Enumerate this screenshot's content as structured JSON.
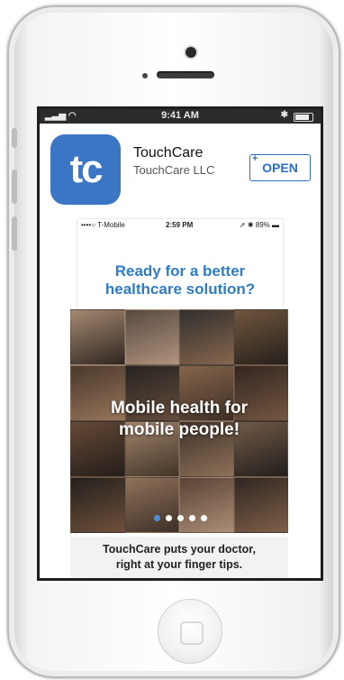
{
  "status_bar": {
    "time": "9:41 AM"
  },
  "app": {
    "icon_text": "tc",
    "name": "TouchCare",
    "developer": "TouchCare LLC",
    "open_label": "OPEN",
    "open_plus": "+"
  },
  "preview": {
    "status": {
      "carrier": "••••○ T-Mobile",
      "time": "2:59 PM",
      "battery": "89%"
    },
    "headline_line1": "Ready for a better",
    "headline_line2": "healthcare solution?",
    "overlay_line1": "Mobile health for",
    "overlay_line2": "mobile people!",
    "pager": {
      "count": 5,
      "active_index": 0
    },
    "tagline_line1": "TouchCare puts your doctor,",
    "tagline_line2": "right at your finger tips."
  },
  "colors": {
    "brand_blue": "#3a76c4",
    "headline_blue": "#2e7cc4",
    "open_blue": "#2a6fc9"
  }
}
